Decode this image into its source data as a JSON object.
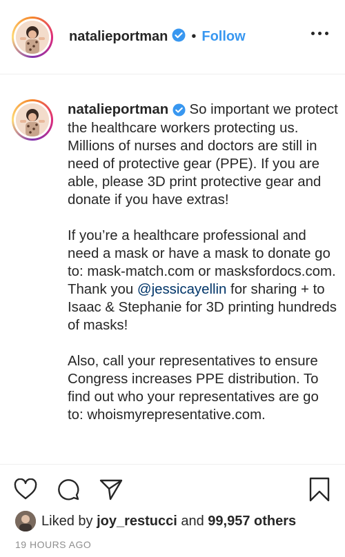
{
  "header": {
    "username": "natalieportman",
    "separator": "•",
    "follow_label": "Follow"
  },
  "caption": {
    "username": "natalieportman",
    "p1": "So important we protect the healthcare workers protecting us. Millions of nurses and doctors are still in need of protective gear (PPE). If you are able, please 3D print protective gear and donate if you have extras!",
    "p2_before": "If you’re a healthcare professional and need a mask or have a mask to donate go to: mask-match.com or masksfordocs.com. Thank you ",
    "p2_mention": "@jessicayellin",
    "p2_after": " for sharing + to Isaac & Stephanie for 3D printing hundreds of masks!",
    "p3": "Also, call your representatives to ensure Congress increases PPE distribution. To find out who your representatives are go to: whoismyrepresentative.com."
  },
  "likes": {
    "prefix": "Liked by",
    "user": "joy_restucci",
    "joiner": "and",
    "count": "99,957 others"
  },
  "timestamp": "19 HOURS AGO",
  "colors": {
    "accent": "#3897f0",
    "verified": "#3897f0",
    "mention": "#003569",
    "muted": "#8e8e8e"
  },
  "icons": [
    "verified-badge-icon",
    "more-options-icon",
    "heart-icon",
    "comment-icon",
    "share-icon",
    "bookmark-icon"
  ]
}
